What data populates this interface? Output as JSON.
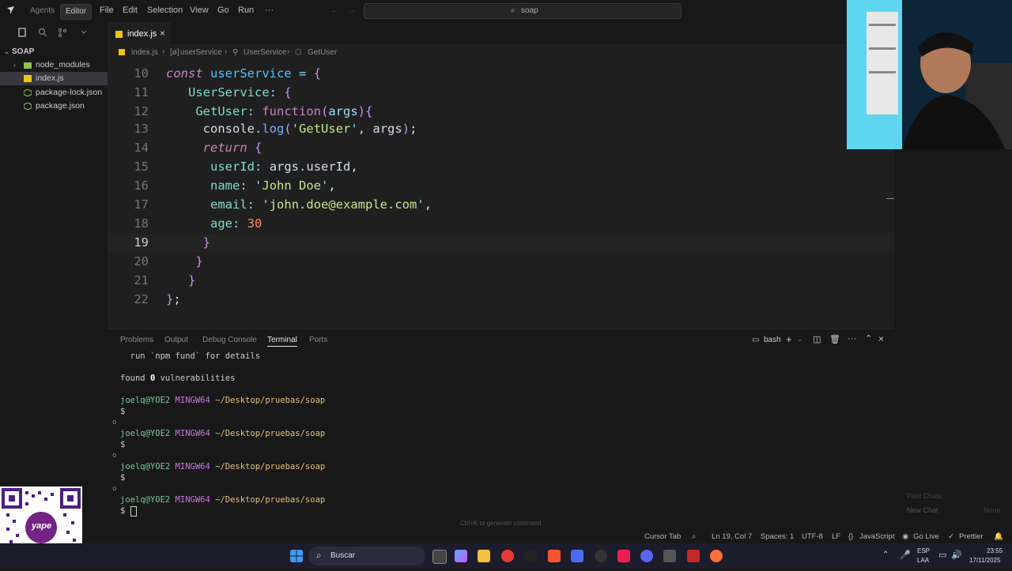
{
  "titlebar": {
    "modes": [
      "Agents",
      "Editor"
    ],
    "menu": [
      "File",
      "Edit",
      "Selection",
      "View",
      "Go",
      "Run",
      "···"
    ],
    "search_text": "soap"
  },
  "sidebar": {
    "folder": "SOAP",
    "items": [
      {
        "label": "node_modules",
        "icon": "folder-icon"
      },
      {
        "label": "index.js",
        "icon": "js-file-icon"
      },
      {
        "label": "package-lock.json",
        "icon": "node-file-icon"
      },
      {
        "label": "package.json",
        "icon": "node-file-icon"
      }
    ]
  },
  "editor": {
    "tab_label": "index.js",
    "breadcrumb": [
      "index.js",
      "userService",
      "UserService",
      "GetUser"
    ],
    "current_line": 19,
    "line_numbers": [
      "10",
      "11",
      "12",
      "13",
      "14",
      "15",
      "16",
      "17",
      "18",
      "19",
      "20",
      "21",
      "22"
    ]
  },
  "panel": {
    "tabs": [
      "Problems",
      "Output",
      "Debug Console",
      "Terminal",
      "Ports"
    ],
    "active_tab": "Terminal",
    "shell": "bash",
    "terminal": {
      "fund_line": "run `npm fund` for details",
      "found_prefix": "found ",
      "found_count": "0",
      "found_suffix": " vulnerabilities",
      "user": "joelq@YOE2",
      "system": "MINGW64",
      "path": "~/Desktop/pruebas/soap",
      "prompt": "$",
      "empty_marker": "o"
    }
  },
  "rightpane": {
    "past_chats": "Past Chats",
    "new_chat": "New Chat",
    "none": "None",
    "hint": "Ctrl+K to generate command"
  },
  "statusbar": {
    "cursor_tab": "Cursor Tab",
    "position": "Ln 19, Col 7",
    "spaces": "Spaces: 1",
    "encoding": "UTF-8",
    "eol": "LF",
    "language": "JavaScript",
    "golive": "Go Live",
    "prettier": "Prettier"
  },
  "taskbar": {
    "search": "Buscar",
    "lang": "ESP",
    "region": "LAA",
    "time": "23:55",
    "date": "17/11/2025"
  },
  "overlay": {
    "qr_text": "yape"
  },
  "colors": {
    "accent_keyword": "#c586c0",
    "string": "#c3e88d",
    "number": "#f78c6c",
    "terminal_user": "#7ec699",
    "terminal_system": "#c678dd",
    "terminal_path": "#e5c07b"
  }
}
